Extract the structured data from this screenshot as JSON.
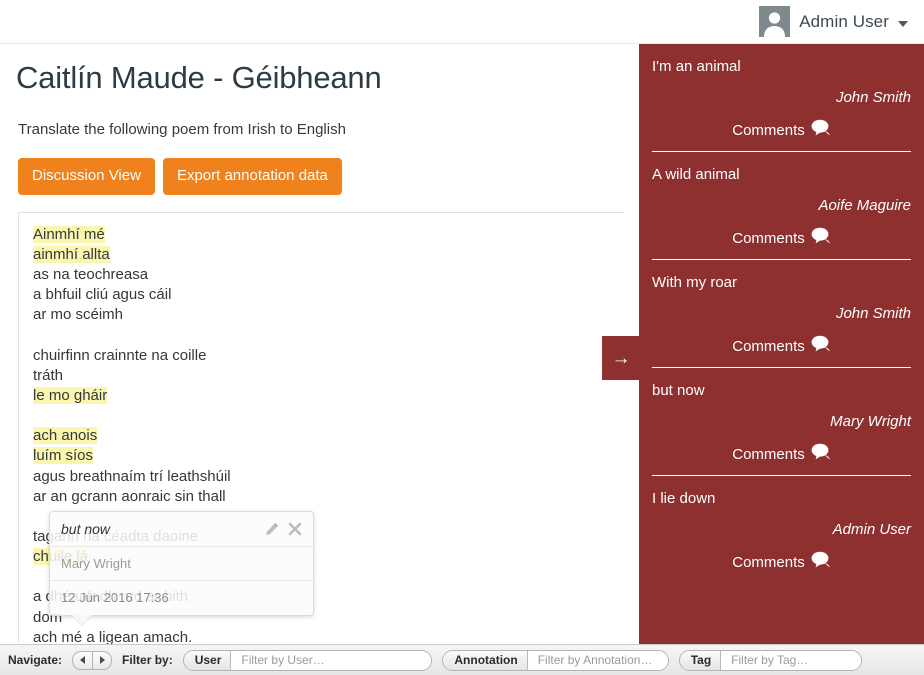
{
  "topbar": {
    "user_name": "Admin User",
    "avatar_icon": "user-avatar-icon",
    "caret_icon": "chevron-down-icon"
  },
  "main": {
    "page_title": "Caitlín Maude - Géibheann",
    "instructions": "Translate the following poem from Irish to English",
    "buttons": {
      "discussion_view": "Discussion View",
      "export": "Export annotation data"
    },
    "poem_lines": [
      {
        "text": "Ainmhí mé",
        "highlight": true
      },
      {
        "text": "ainmhí allta",
        "highlight": true
      },
      {
        "text": "as na teochreasa",
        "highlight": false
      },
      {
        "text": "a bhfuil cliú agus cáil",
        "highlight": false
      },
      {
        "text": "ar mo scéimh",
        "highlight": false
      },
      {
        "text": "",
        "highlight": false
      },
      {
        "text": "chuirfinn crainnte na coille",
        "highlight": false
      },
      {
        "text": "tráth",
        "highlight": false
      },
      {
        "text": "le mo gháir",
        "highlight": true
      },
      {
        "text": "",
        "highlight": false
      },
      {
        "text": "ach anois",
        "highlight": true
      },
      {
        "text": "luím síos",
        "highlight": true
      },
      {
        "text": "agus breathnaím trí leathshúil",
        "highlight": false
      },
      {
        "text": "ar an gcrann aonraic sin thall",
        "highlight": false
      },
      {
        "text": "",
        "highlight": false
      },
      {
        "text": "tagann na céadta daoine",
        "highlight": false
      },
      {
        "text": "chuile lá",
        "highlight": true
      },
      {
        "text": "",
        "highlight": false
      },
      {
        "text": "a dhéanfadh rud ar bith",
        "highlight": false
      },
      {
        "text": "dom",
        "highlight": false
      },
      {
        "text": "ach mé a ligean amach.",
        "highlight": false
      }
    ]
  },
  "popup": {
    "quote": "but now",
    "user": "Mary Wright",
    "date": "12 Jun 2016 17:36",
    "edit_icon": "pencil-icon",
    "close_icon": "close-icon"
  },
  "side_toggle": {
    "icon": "arrow-right-icon",
    "glyph": "→"
  },
  "sidebar": {
    "annotations": [
      {
        "text": "I'm an animal",
        "author": "John Smith",
        "comments_label": "Comments",
        "comments_icon": "comment-bubble-icon"
      },
      {
        "text": "A wild animal",
        "author": "Aoife Maguire",
        "comments_label": "Comments",
        "comments_icon": "comment-bubble-icon"
      },
      {
        "text": "With my roar",
        "author": "John Smith",
        "comments_label": "Comments",
        "comments_icon": "comment-bubble-icon"
      },
      {
        "text": "but now",
        "author": "Mary Wright",
        "comments_label": "Comments",
        "comments_icon": "comment-bubble-icon"
      },
      {
        "text": "I lie down",
        "author": "Admin User",
        "comments_label": "Comments",
        "comments_icon": "comment-bubble-icon"
      }
    ]
  },
  "bottombar": {
    "navigate_label": "Navigate:",
    "prev_icon": "arrow-left-icon",
    "next_icon": "arrow-right-icon",
    "filter_by_label": "Filter by:",
    "user_tag": "User",
    "user_placeholder": "Filter by User…",
    "user_value": "",
    "annotation_tag": "Annotation",
    "annotation_placeholder": "Filter by Annotation…",
    "annotation_value": "",
    "tag_tag": "Tag",
    "tag_placeholder": "Filter by Tag…",
    "tag_value": ""
  },
  "colors": {
    "accent_orange": "#f0821e",
    "sidebar_red": "#8e3030",
    "highlight_yellow": "#fbf6ae",
    "avatar_gray": "#7e8a8c"
  }
}
